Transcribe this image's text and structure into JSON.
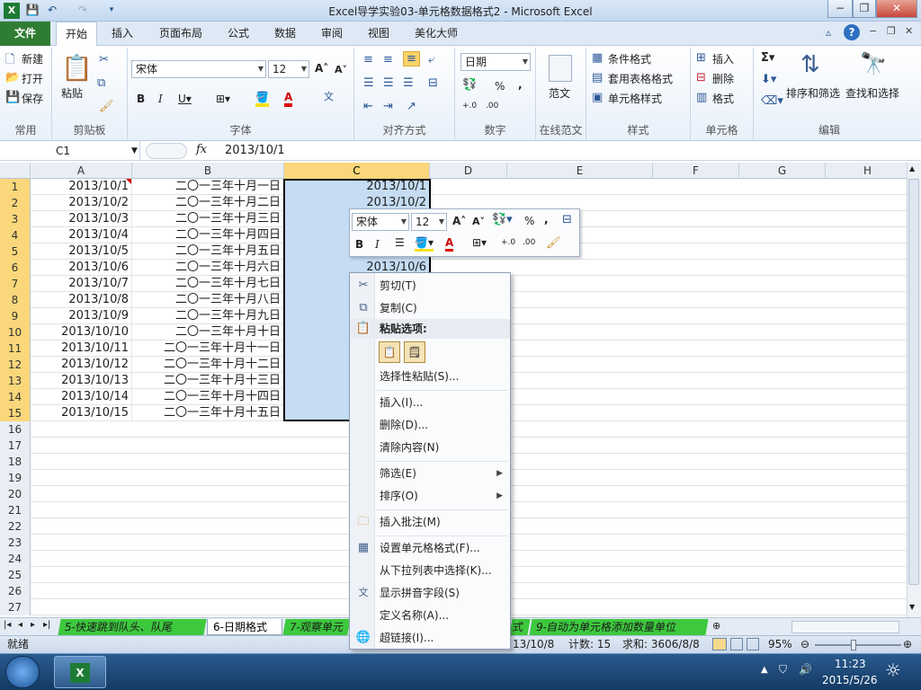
{
  "window": {
    "title": "Excel导学实验03-单元格数据格式2 - Microsoft Excel"
  },
  "tabs": [
    "文件",
    "开始",
    "插入",
    "页面布局",
    "公式",
    "数据",
    "审阅",
    "视图",
    "美化大师"
  ],
  "ribbon": {
    "common": {
      "new": "新建",
      "open": "打开",
      "save": "保存",
      "label": "常用"
    },
    "clipboard": {
      "paste": "粘贴",
      "label": "剪贴板"
    },
    "font": {
      "name": "宋体",
      "size": "12",
      "label": "字体"
    },
    "align": {
      "label": "对齐方式"
    },
    "number": {
      "format": "日期",
      "label": "数字"
    },
    "template": {
      "btn": "范文",
      "label": "在线范文"
    },
    "styles": {
      "cond": "条件格式",
      "table": "套用表格格式",
      "cell": "单元格样式",
      "label": "样式"
    },
    "cells": {
      "insert": "插入",
      "delete": "删除",
      "format": "格式",
      "label": "单元格"
    },
    "editing": {
      "sort": "排序和筛选",
      "find": "查找和选择",
      "label": "编辑"
    }
  },
  "formula": {
    "name_box": "C1",
    "fx": "fx",
    "value": "2013/10/1"
  },
  "columns": [
    "A",
    "B",
    "C",
    "D",
    "E",
    "F",
    "G",
    "H"
  ],
  "rows_a": [
    "2013/10/1",
    "2013/10/2",
    "2013/10/3",
    "2013/10/4",
    "2013/10/5",
    "2013/10/6",
    "2013/10/7",
    "2013/10/8",
    "2013/10/9",
    "2013/10/10",
    "2013/10/11",
    "2013/10/12",
    "2013/10/13",
    "2013/10/14",
    "2013/10/15"
  ],
  "rows_b": [
    "二〇一三年十月一日",
    "二〇一三年十月二日",
    "二〇一三年十月三日",
    "二〇一三年十月四日",
    "二〇一三年十月五日",
    "二〇一三年十月六日",
    "二〇一三年十月七日",
    "二〇一三年十月八日",
    "二〇一三年十月九日",
    "二〇一三年十月十日",
    "二〇一三年十月十一日",
    "二〇一三年十月十二日",
    "二〇一三年十月十三日",
    "二〇一三年十月十四日",
    "二〇一三年十月十五日"
  ],
  "rows_c_visible": {
    "r1": "2013/10/1",
    "r2": "2013/10/2",
    "r6": "2013/10/6"
  },
  "minitoolbar": {
    "font": "宋体",
    "size": "12"
  },
  "context_menu": {
    "cut": "剪切(T)",
    "copy": "复制(C)",
    "paste_options": "粘贴选项:",
    "paste_special": "选择性粘贴(S)...",
    "insert": "插入(I)...",
    "delete": "删除(D)...",
    "clear": "清除内容(N)",
    "filter": "筛选(E)",
    "sort": "排序(O)",
    "comment": "插入批注(M)",
    "format_cells": "设置单元格格式(F)...",
    "pick_list": "从下拉列表中选择(K)...",
    "phonetic": "显示拼音字段(S)",
    "define_name": "定义名称(A)...",
    "hyperlink": "超链接(I)..."
  },
  "sheets": {
    "tab5": "5-快速跳到队头、队尾",
    "tab6": "6-日期格式",
    "tab7": "7-观察单元",
    "tab8_tail": "式",
    "tab9": "9-自动为单元格添加数量单位"
  },
  "status": {
    "ready": "就绪",
    "average_tail": "13/10/8",
    "count": "计数: 15",
    "sum": "求和: 3606/8/8",
    "zoom": "95%"
  },
  "taskbar": {
    "time": "11:23",
    "date": "2015/5/26"
  },
  "colors": {
    "file_tab": "#2f7d32",
    "selection": "#c5dcf3",
    "header_selected": "#f9d77a",
    "sheet_green": "#3ec83e"
  }
}
